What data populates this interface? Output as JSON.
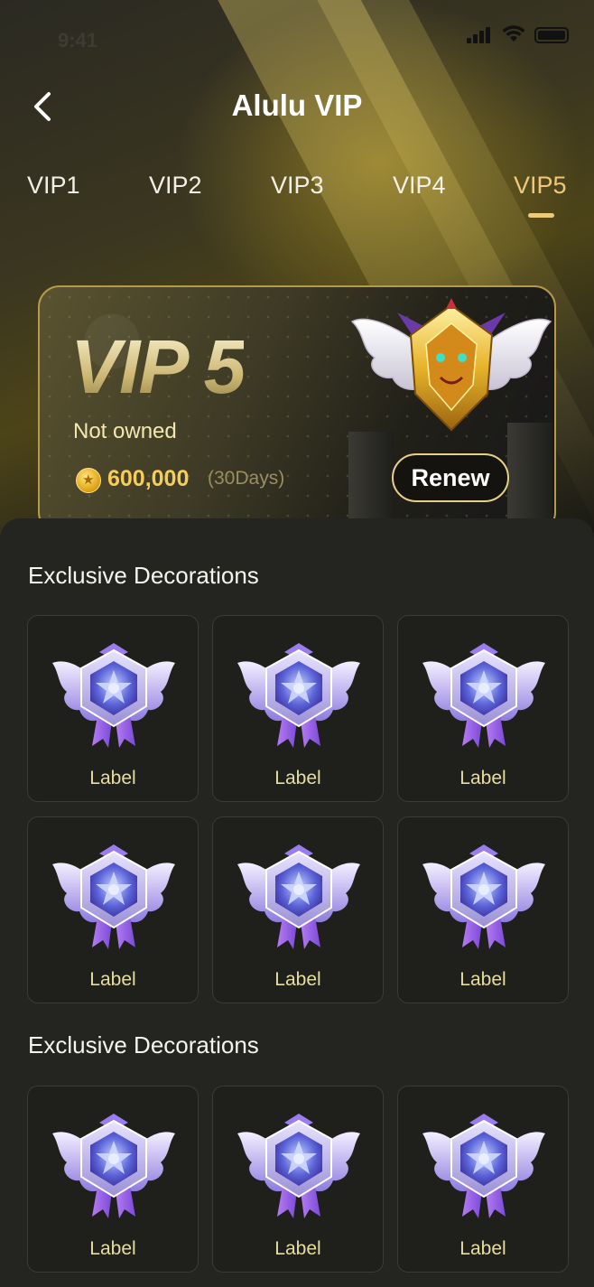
{
  "status_bar": {
    "time": "9:41"
  },
  "header": {
    "title": "Alulu VIP"
  },
  "tabs": [
    {
      "label": "VIP1"
    },
    {
      "label": "VIP2"
    },
    {
      "label": "VIP3"
    },
    {
      "label": "VIP4"
    },
    {
      "label": "VIP5",
      "active": true
    }
  ],
  "card": {
    "level_text": "VIP 5",
    "ownership_status": "Not owned",
    "price": "600,000",
    "duration": "(30Days)",
    "renew_label": "Renew"
  },
  "sections": [
    {
      "title": "Exclusive Decorations",
      "items": [
        {
          "label": "Label"
        },
        {
          "label": "Label"
        },
        {
          "label": "Label"
        },
        {
          "label": "Label"
        },
        {
          "label": "Label"
        },
        {
          "label": "Label"
        }
      ]
    },
    {
      "title": "Exclusive Decorations",
      "items": [
        {
          "label": "Label"
        },
        {
          "label": "Label"
        },
        {
          "label": "Label"
        }
      ]
    }
  ],
  "colors": {
    "accent_gold": "#f0c87a",
    "price_gold": "#f7cd5a",
    "label_text": "#e7dda0",
    "sheet_bg": "#242421"
  },
  "icons": {
    "back": "chevron-left-icon",
    "coin": "coin-icon",
    "vip_badge": "winged-dragon-badge-icon",
    "decoration": "winged-star-medal-icon"
  }
}
